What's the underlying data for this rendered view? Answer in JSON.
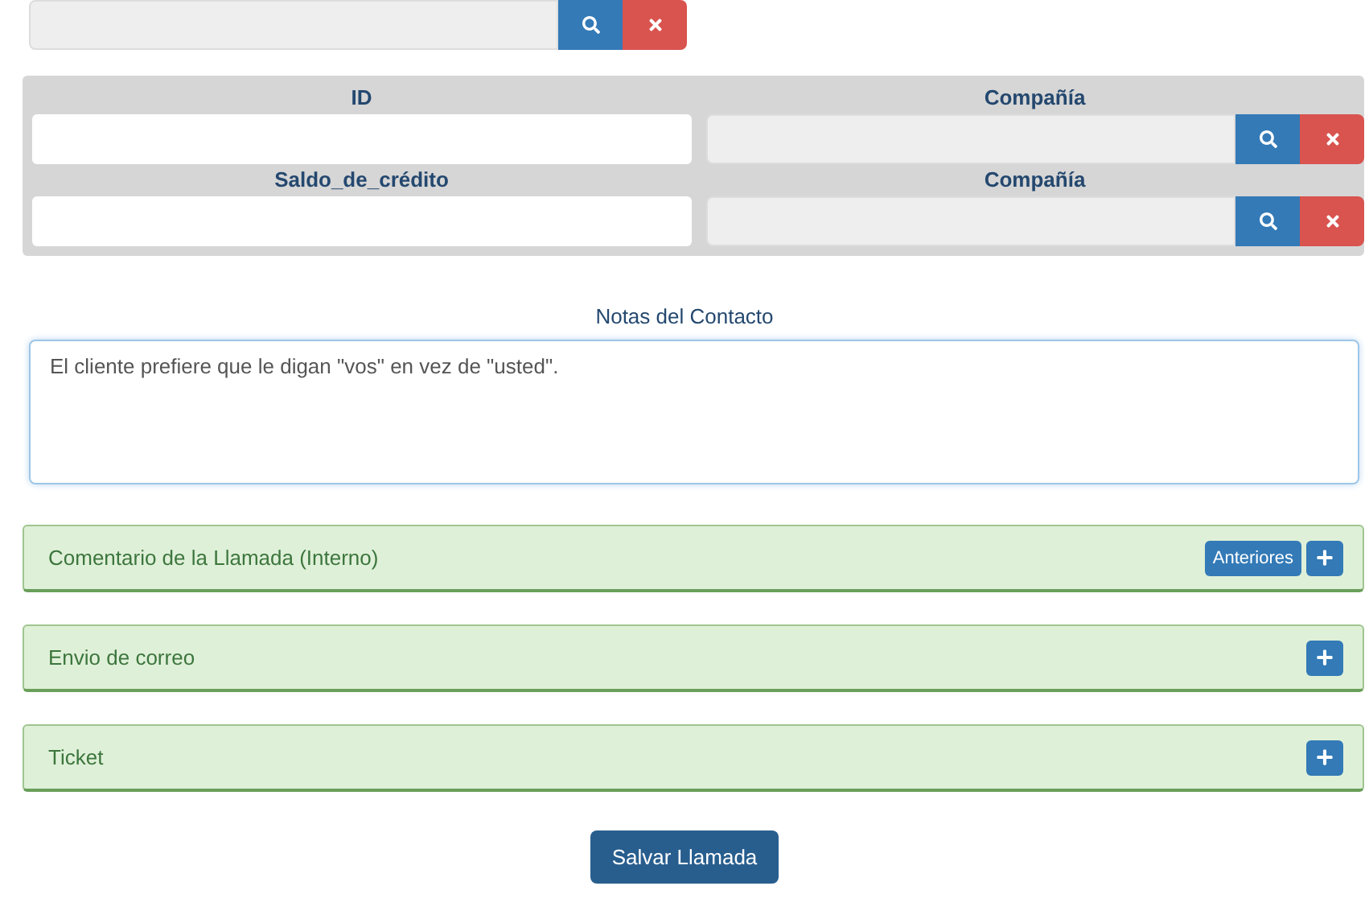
{
  "lookup_panel": {
    "rows": [
      {
        "left_label": "ID",
        "right_label": "Compañía"
      },
      {
        "left_label": "Saldo_de_crédito",
        "right_label": "Compañía"
      }
    ]
  },
  "notes": {
    "label": "Notas del Contacto",
    "value": "El cliente prefiere que le digan \"vos\" en vez de \"usted\"."
  },
  "sections": [
    {
      "title": "Comentario de la Llamada (Interno)",
      "extra_button": "Anteriores"
    },
    {
      "title": "Envio de correo"
    },
    {
      "title": "Ticket"
    }
  ],
  "save_button": "Salvar Llamada"
}
